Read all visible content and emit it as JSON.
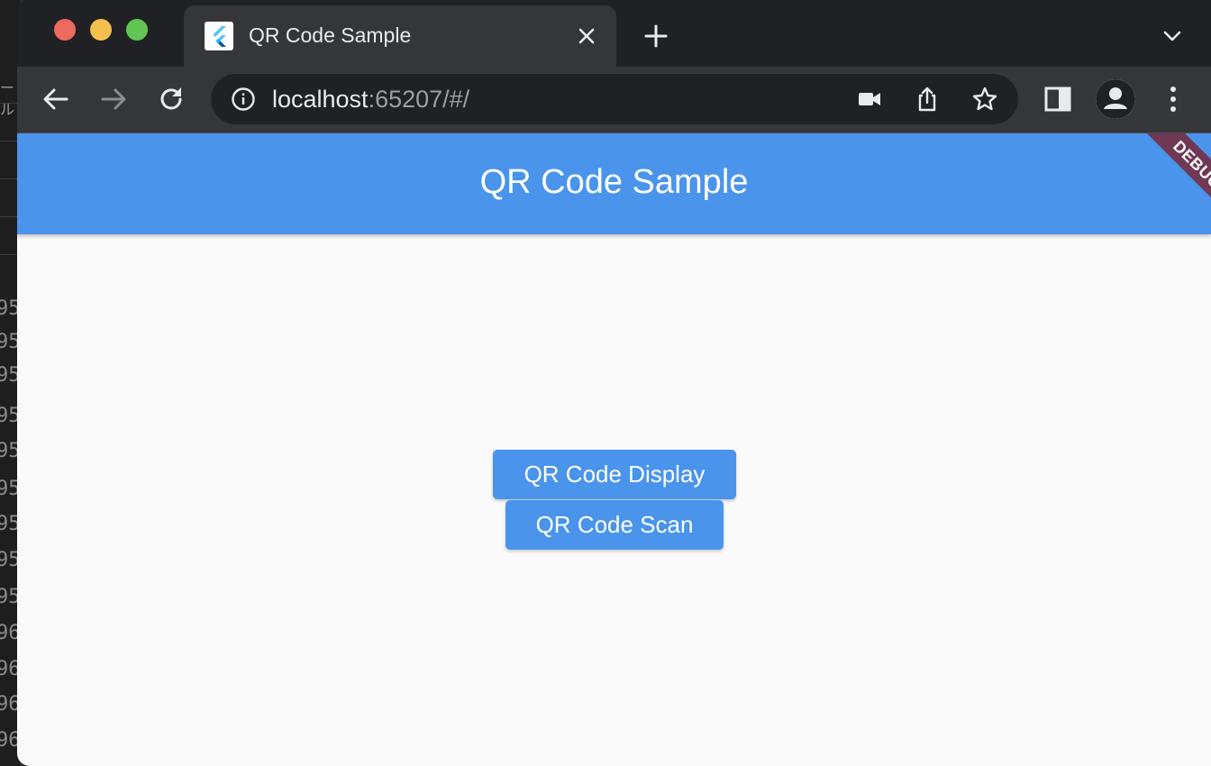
{
  "background_window": {
    "fragment_text": "ール",
    "line_numbers": [
      "95",
      "95",
      "95",
      "95",
      "95",
      "95",
      "95",
      "95",
      "95",
      "96",
      "96",
      "96",
      "96"
    ]
  },
  "browser": {
    "tab": {
      "title": "QR Code Sample",
      "favicon": "flutter-icon"
    },
    "address_bar": {
      "host": "localhost",
      "rest": ":65207/#/"
    },
    "icons": {
      "back": "arrow-left-icon",
      "forward": "arrow-right-icon",
      "reload": "reload-icon",
      "info": "info-icon",
      "camera": "video-camera-icon",
      "share": "share-icon",
      "bookmark": "star-icon",
      "side_panel": "side-panel-icon",
      "profile": "profile-icon",
      "menu": "kebab-menu-icon",
      "new_tab": "plus-icon",
      "tab_close": "close-icon",
      "tab_search": "chevron-down-icon"
    }
  },
  "app": {
    "title": "QR Code Sample",
    "debug_banner": "DEBUG",
    "buttons": {
      "display": "QR Code Display",
      "scan": "QR Code Scan"
    },
    "colors": {
      "primary": "#4a94ec",
      "background": "#fafafa",
      "debug_banner": "#78283c"
    }
  }
}
